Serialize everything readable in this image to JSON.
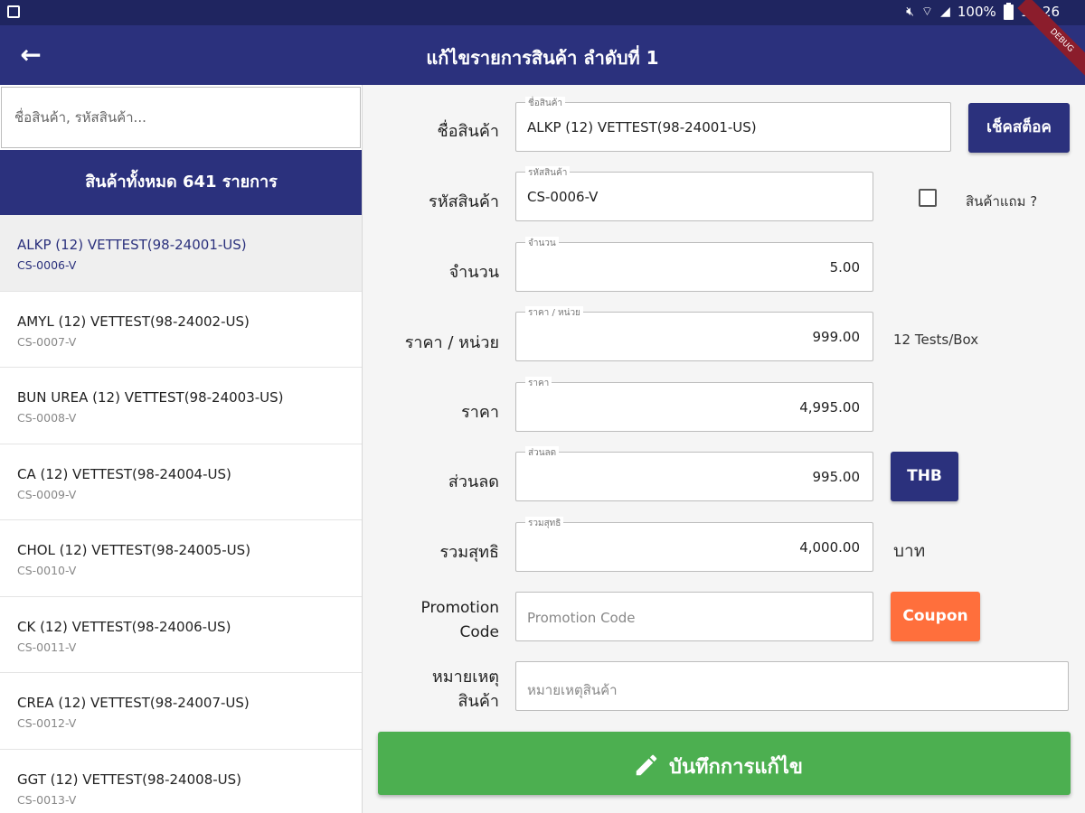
{
  "status_bar": {
    "battery": "100%",
    "time": "14:26",
    "icons": [
      "screenshot-icon",
      "mute-icon",
      "wifi-icon",
      "signal-icon",
      "battery-icon"
    ]
  },
  "app_bar": {
    "title": "แก้ไขรายการสินค้า ลำดับที่  1",
    "back_icon": "arrow-back-icon",
    "debug_ribbon": "DEBUG"
  },
  "sidebar": {
    "search_placeholder": "ชื่อสินค้า, รหัสสินค้า...",
    "count_label": "สินค้าทั้งหมด 641 รายการ",
    "items": [
      {
        "name": "ALKP (12) VETTEST(98-24001-US)",
        "code": "CS-0006-V"
      },
      {
        "name": "AMYL (12) VETTEST(98-24002-US)",
        "code": "CS-0007-V"
      },
      {
        "name": "BUN UREA (12) VETTEST(98-24003-US)",
        "code": "CS-0008-V"
      },
      {
        "name": "CA (12) VETTEST(98-24004-US)",
        "code": "CS-0009-V"
      },
      {
        "name": "CHOL (12) VETTEST(98-24005-US)",
        "code": "CS-0010-V"
      },
      {
        "name": "CK (12) VETTEST(98-24006-US)",
        "code": "CS-0011-V"
      },
      {
        "name": "CREA (12) VETTEST(98-24007-US)",
        "code": "CS-0012-V"
      },
      {
        "name": "GGT (12) VETTEST(98-24008-US)",
        "code": "CS-0013-V"
      }
    ]
  },
  "form": {
    "product_name": {
      "label": "ชื่อสินค้า",
      "float_label": "ชื่อสินค้า",
      "value": "ALKP (12) VETTEST(98-24001-US)"
    },
    "check_stock_button": "เช็คสต็อค",
    "product_code": {
      "label": "รหัสสินค้า",
      "float_label": "รหัสสินค้า",
      "value": "CS-0006-V"
    },
    "free_item_label": "สินค้าแถม ?",
    "quantity": {
      "label": "จำนวน",
      "float_label": "จำนวน",
      "value": "5.00"
    },
    "unit_price": {
      "label": "ราคา / หน่วย",
      "float_label": "ราคา / หน่วย",
      "value": "999.00"
    },
    "unit_note": "12 Tests/Box",
    "price": {
      "label": "ราคา",
      "float_label": "ราคา",
      "value": "4,995.00"
    },
    "discount": {
      "label": "ส่วนลด",
      "float_label": "ส่วนลด",
      "value": "995.00"
    },
    "currency_button": "THB",
    "net_total": {
      "label": "รวมสุทธิ",
      "float_label": "รวมสุทธิ",
      "value": "4,000.00"
    },
    "net_unit": "บาท",
    "promotion": {
      "label_line1": "Promotion",
      "label_line2": "Code",
      "placeholder": "Promotion Code"
    },
    "coupon_button": "Coupon",
    "remark": {
      "label_line1": "หมายเหตุ",
      "label_line2": "สินค้า",
      "placeholder": "หมายเหตุสินค้า"
    },
    "save_button": "บันทึกการแก้ไข"
  },
  "colors": {
    "primary": "#2b317d",
    "status_bar": "#1f2560",
    "save": "#4caf50",
    "coupon": "#ff6f3c"
  }
}
